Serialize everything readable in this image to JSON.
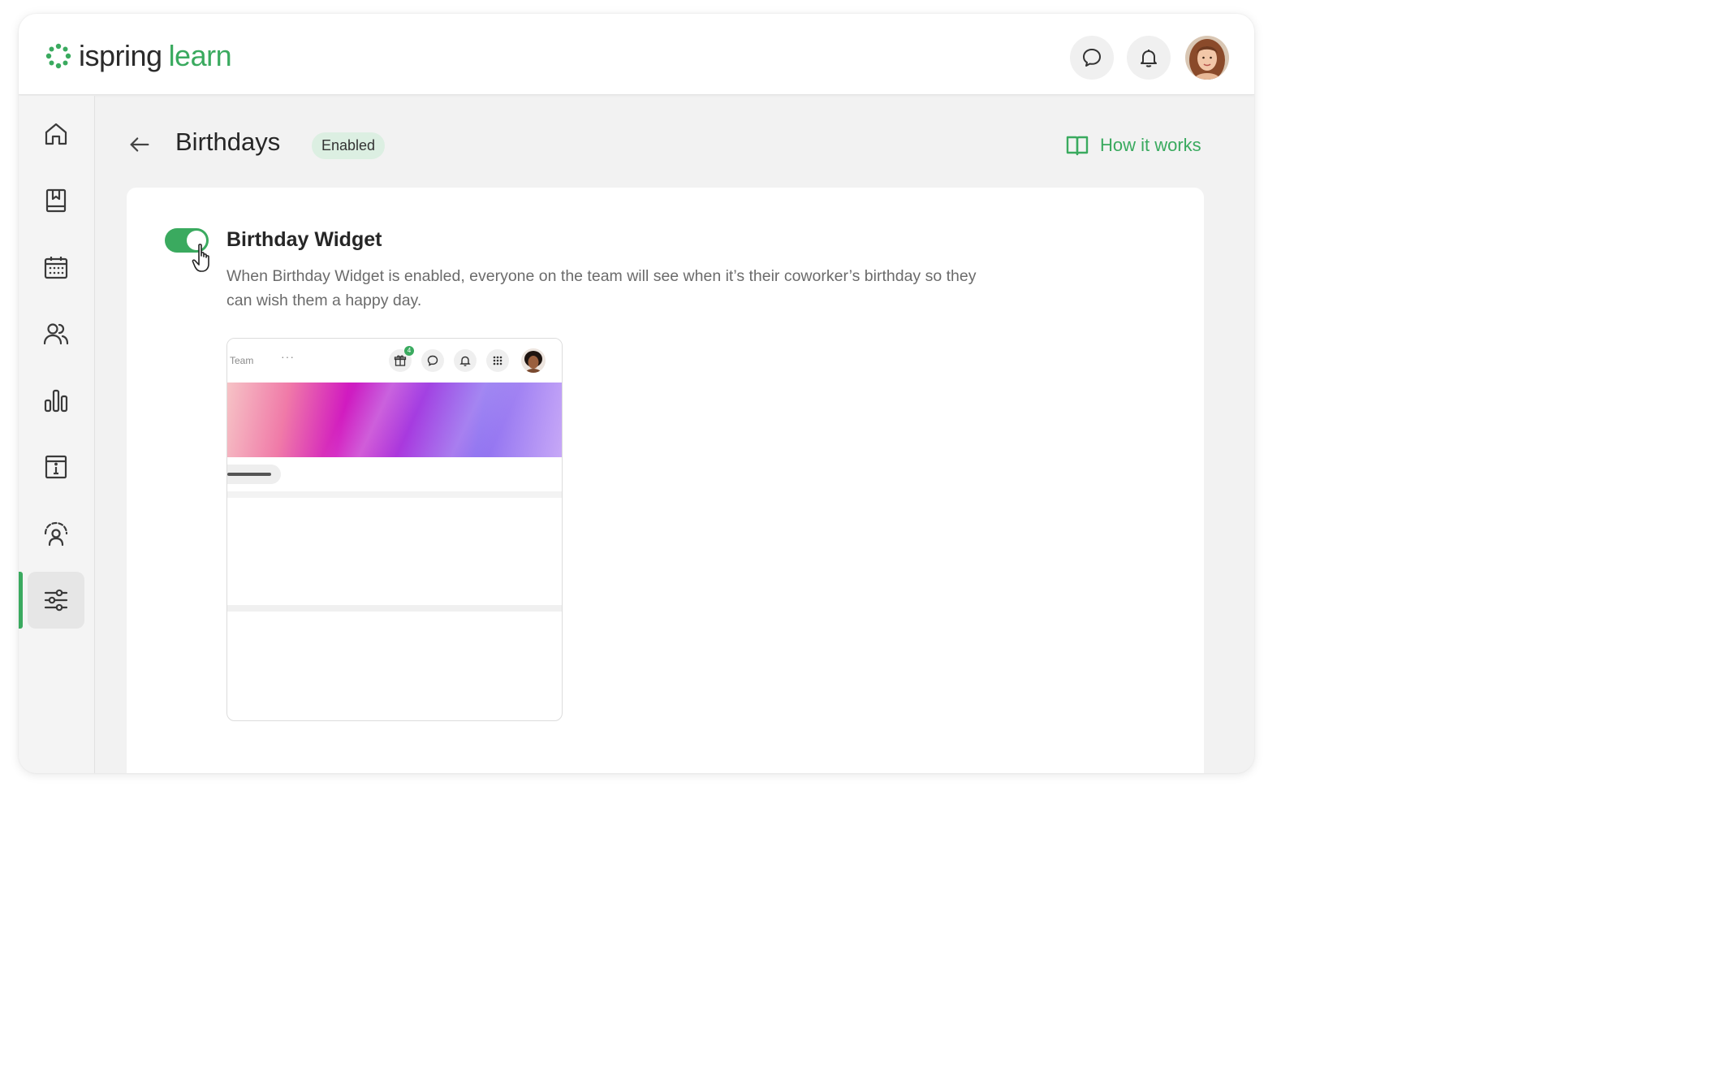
{
  "header": {
    "logo_primary": "ispring",
    "logo_secondary": "learn",
    "icons": [
      "chat-icon",
      "bell-icon"
    ],
    "colors": {
      "brand_green": "#3aaa5f",
      "text_dark": "#262626"
    }
  },
  "sidebar": {
    "items": [
      {
        "icon": "home-icon"
      },
      {
        "icon": "book-icon"
      },
      {
        "icon": "calendar-icon"
      },
      {
        "icon": "users-icon"
      },
      {
        "icon": "bar-chart-icon"
      },
      {
        "icon": "info-board-icon"
      },
      {
        "icon": "user-gauge-icon"
      },
      {
        "icon": "sliders-icon",
        "active": true
      }
    ]
  },
  "page": {
    "title": "Birthdays",
    "status": "Enabled",
    "help_link": "How it works"
  },
  "widget": {
    "enabled": true,
    "title": "Birthday Widget",
    "description": "When Birthday Widget is enabled, everyone on the team will see when it’s their coworker’s birthday so they can wish them a happy day."
  },
  "preview": {
    "title": "Team",
    "more": "···",
    "gift_count": "4"
  }
}
